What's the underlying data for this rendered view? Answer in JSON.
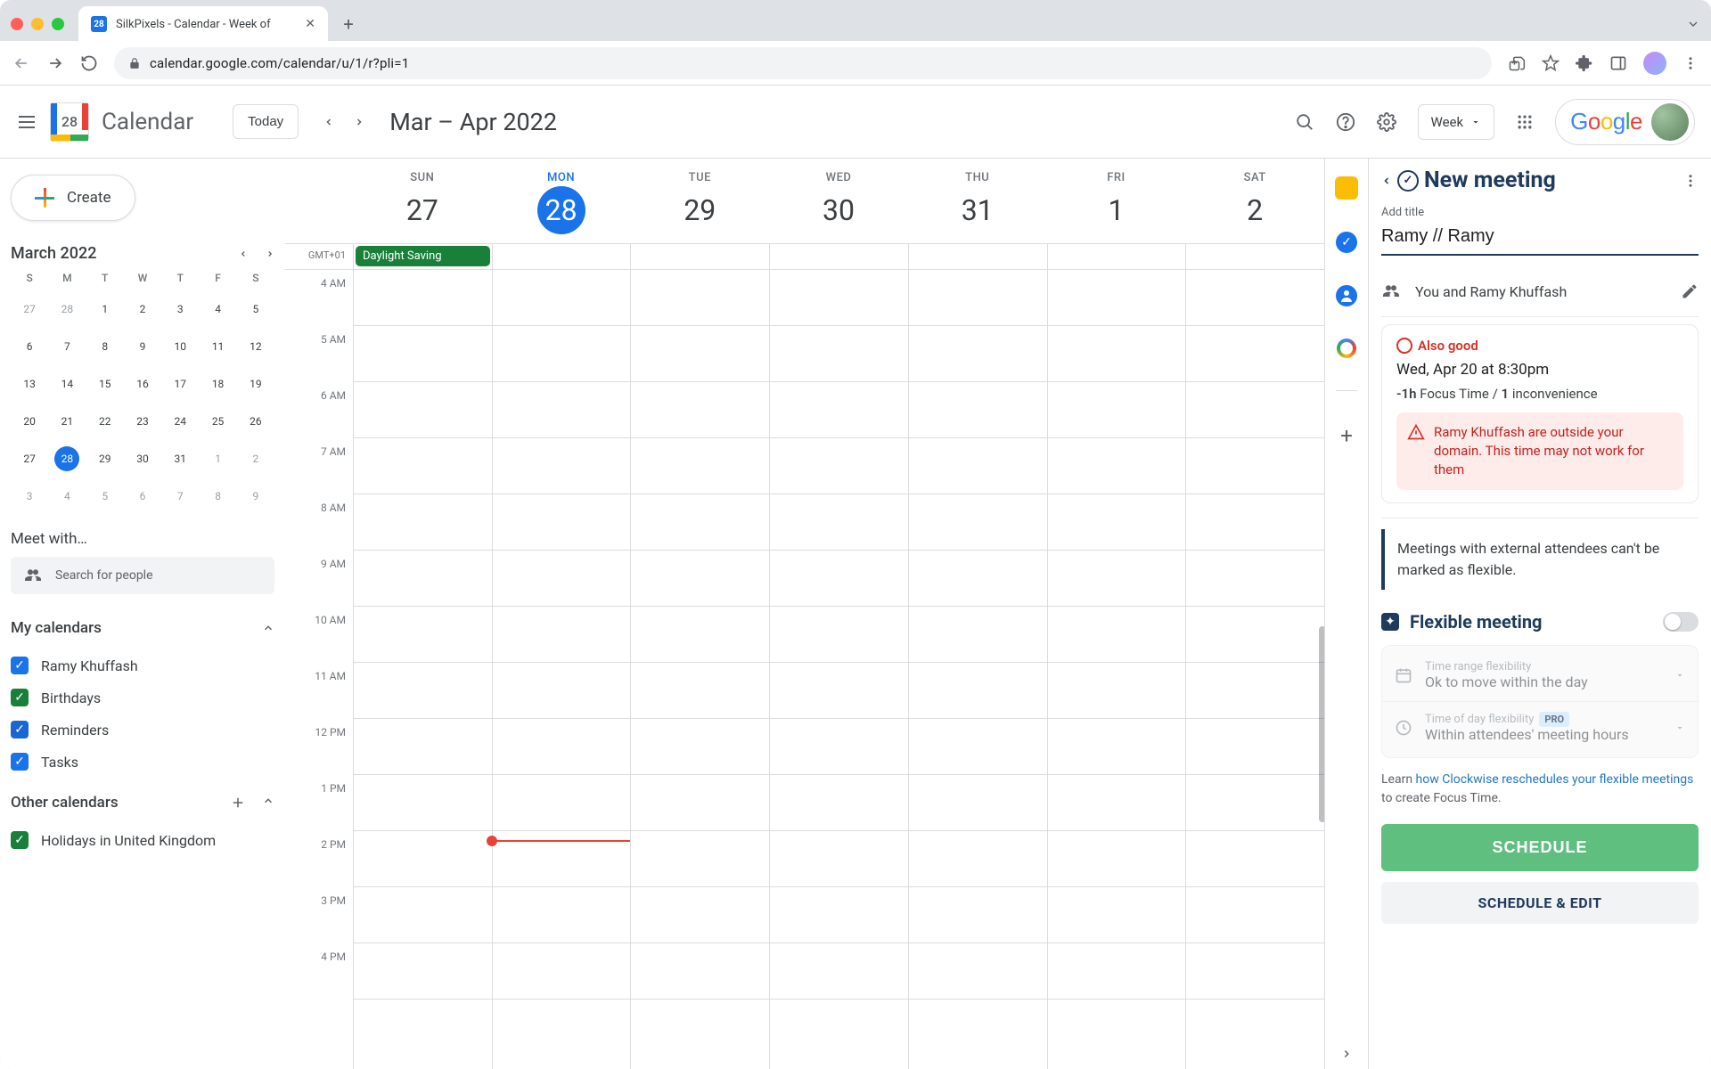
{
  "browser": {
    "tab_title": "SilkPixels - Calendar - Week of",
    "url": "calendar.google.com/calendar/u/1/r?pli=1"
  },
  "header": {
    "brand": "Calendar",
    "today_btn": "Today",
    "date_range": "Mar – Apr 2022",
    "view": "Week"
  },
  "mini_cal": {
    "month": "March 2022",
    "dow": [
      "S",
      "M",
      "T",
      "W",
      "T",
      "F",
      "S"
    ],
    "rows": [
      [
        {
          "n": "27",
          "o": 1
        },
        {
          "n": "28",
          "o": 1
        },
        {
          "n": "1"
        },
        {
          "n": "2"
        },
        {
          "n": "3"
        },
        {
          "n": "4"
        },
        {
          "n": "5"
        }
      ],
      [
        {
          "n": "6"
        },
        {
          "n": "7"
        },
        {
          "n": "8"
        },
        {
          "n": "9"
        },
        {
          "n": "10"
        },
        {
          "n": "11"
        },
        {
          "n": "12"
        }
      ],
      [
        {
          "n": "13"
        },
        {
          "n": "14"
        },
        {
          "n": "15"
        },
        {
          "n": "16"
        },
        {
          "n": "17"
        },
        {
          "n": "18"
        },
        {
          "n": "19"
        }
      ],
      [
        {
          "n": "20"
        },
        {
          "n": "21"
        },
        {
          "n": "22"
        },
        {
          "n": "23"
        },
        {
          "n": "24"
        },
        {
          "n": "25"
        },
        {
          "n": "26"
        }
      ],
      [
        {
          "n": "27"
        },
        {
          "n": "28",
          "t": 1
        },
        {
          "n": "29"
        },
        {
          "n": "30"
        },
        {
          "n": "31"
        },
        {
          "n": "1",
          "o": 1
        },
        {
          "n": "2",
          "o": 1
        }
      ],
      [
        {
          "n": "3",
          "o": 1
        },
        {
          "n": "4",
          "o": 1
        },
        {
          "n": "5",
          "o": 1
        },
        {
          "n": "6",
          "o": 1
        },
        {
          "n": "7",
          "o": 1
        },
        {
          "n": "8",
          "o": 1
        },
        {
          "n": "9",
          "o": 1
        }
      ]
    ]
  },
  "sidebar": {
    "create": "Create",
    "meet_with": "Meet with…",
    "search_placeholder": "Search for people",
    "my_calendars": "My calendars",
    "other_calendars": "Other calendars",
    "my_items": [
      {
        "label": "Ramy Khuffash",
        "color": "#1a73e8"
      },
      {
        "label": "Birthdays",
        "color": "#188038"
      },
      {
        "label": "Reminders",
        "color": "#1967d2"
      },
      {
        "label": "Tasks",
        "color": "#1a73e8"
      }
    ],
    "other_items": [
      {
        "label": "Holidays in United Kingdom",
        "color": "#188038"
      }
    ]
  },
  "week": {
    "tz": "GMT+01",
    "days": [
      {
        "dow": "SUN",
        "num": "27"
      },
      {
        "dow": "MON",
        "num": "28",
        "today": true
      },
      {
        "dow": "TUE",
        "num": "29"
      },
      {
        "dow": "WED",
        "num": "30"
      },
      {
        "dow": "THU",
        "num": "31"
      },
      {
        "dow": "FRI",
        "num": "1"
      },
      {
        "dow": "SAT",
        "num": "2"
      }
    ],
    "allday_event": "Daylight Saving",
    "hours": [
      "4 AM",
      "5 AM",
      "6 AM",
      "7 AM",
      "8 AM",
      "9 AM",
      "10 AM",
      "11 AM",
      "12 PM",
      "1 PM",
      "2 PM",
      "3 PM",
      "4 PM"
    ]
  },
  "panel": {
    "title": "New meeting",
    "add_title_label": "Add title",
    "meeting_title": "Ramy // Ramy",
    "attendees": "You and Ramy Khuffash",
    "suggestion": {
      "tag": "Also good",
      "when": "Wed, Apr 20 at 8:30pm",
      "focus_delta": "-1h",
      "focus_label": "Focus Time /",
      "inconv_count": "1",
      "inconv_label": "inconvenience",
      "warning": "Ramy Khuffash are outside your domain. This time may not work for them"
    },
    "info_note": "Meetings with external attendees can't be marked as flexible.",
    "flex_title": "Flexible meeting",
    "flex_range_label": "Time range flexibility",
    "flex_range_value": "Ok to move within the day",
    "flex_tod_label": "Time of day flexibility",
    "flex_tod_badge": "PRO",
    "flex_tod_value": "Within attendees' meeting hours",
    "learn_prefix": "Learn ",
    "learn_link": "how Clockwise reschedules your flexible meetings",
    "learn_suffix": "  to create Focus Time.",
    "schedule_btn": "SCHEDULE",
    "schedule_edit": "SCHEDULE & EDIT"
  }
}
